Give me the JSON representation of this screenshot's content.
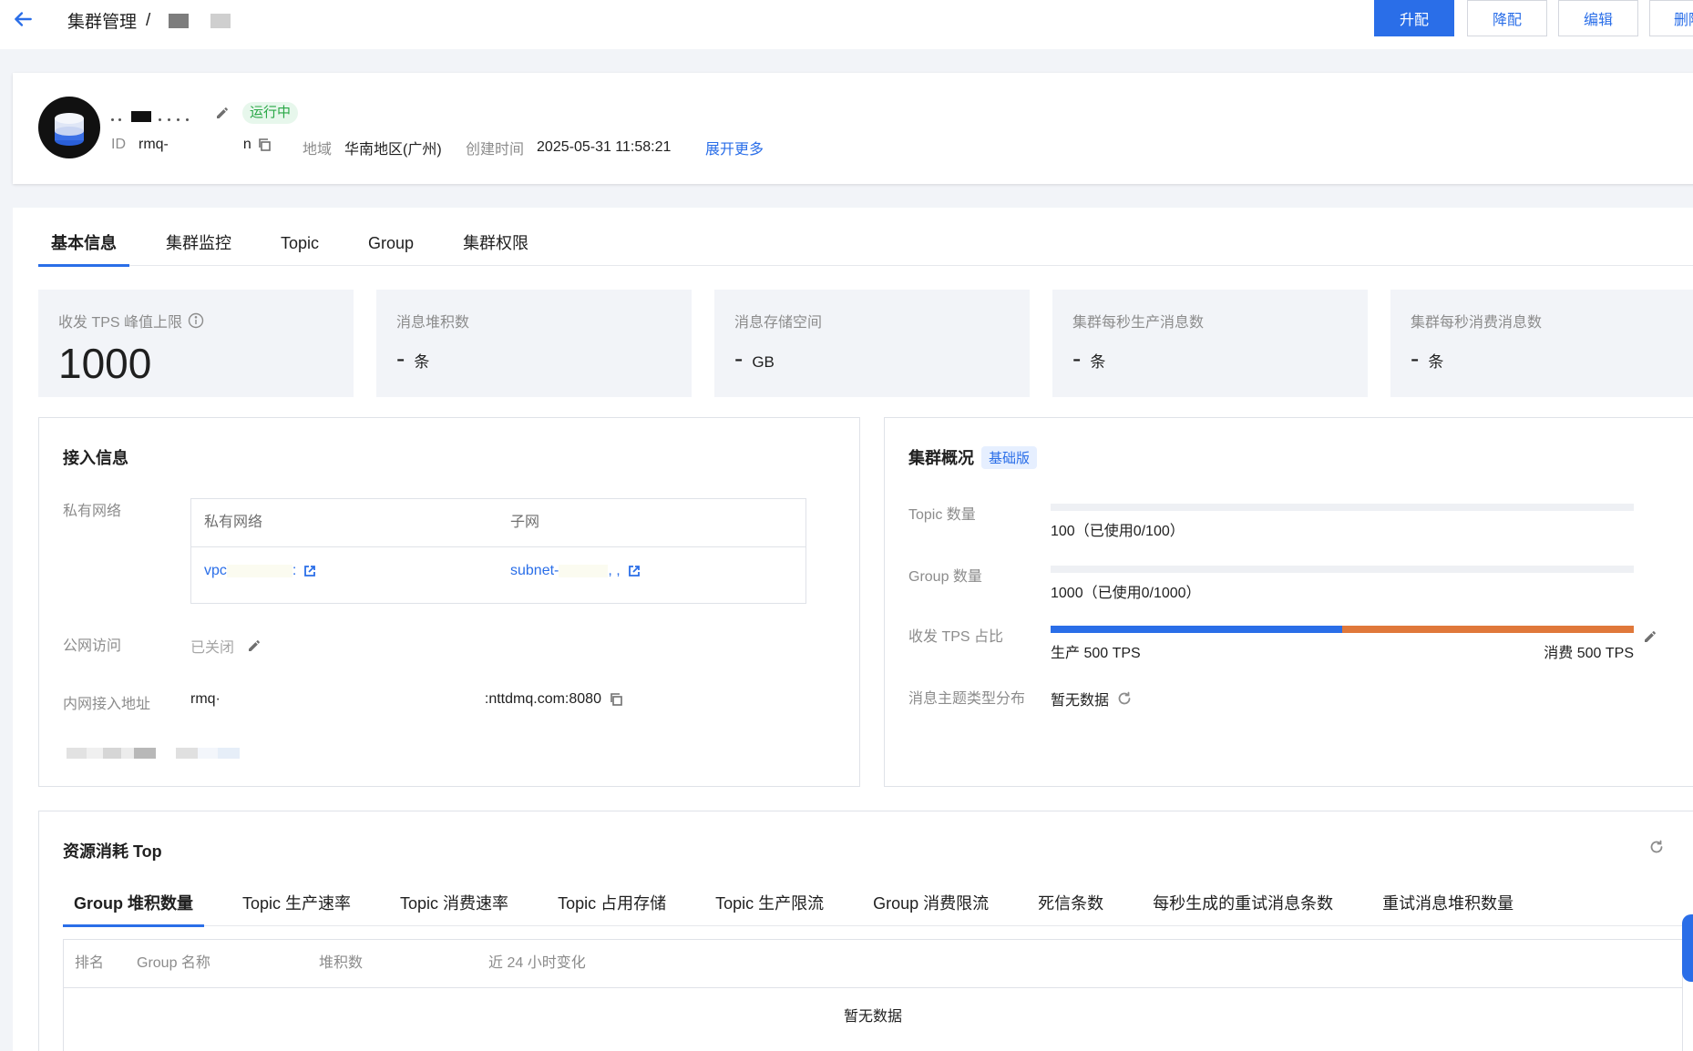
{
  "header": {
    "breadcrumb_root": "集群管理",
    "breadcrumb_sep": "/"
  },
  "toolbar": {
    "upgrade_label": "升配",
    "downgrade_label": "降配",
    "edit_label": "编辑",
    "delete_label": "删除"
  },
  "instance": {
    "status": "运行中",
    "id_label": "ID",
    "id_prefix": "rmq-",
    "id_suffix": "n",
    "region_label": "地域",
    "region_value": "华南地区(广州)",
    "created_label": "创建时间",
    "created_value": "2025-05-31 11:58:21",
    "expand_label": "展开更多"
  },
  "tabs": [
    {
      "label": "基本信息"
    },
    {
      "label": "集群监控"
    },
    {
      "label": "Topic"
    },
    {
      "label": "Group"
    },
    {
      "label": "集群权限"
    }
  ],
  "stats": [
    {
      "label": "收发 TPS 峰值上限",
      "value": "1000",
      "unit": ""
    },
    {
      "label": "消息堆积数",
      "value": "-",
      "unit": "条"
    },
    {
      "label": "消息存储空间",
      "value": "-",
      "unit": "GB"
    },
    {
      "label": "集群每秒生产消息数",
      "value": "-",
      "unit": "条"
    },
    {
      "label": "集群每秒消费消息数",
      "value": "-",
      "unit": "条"
    }
  ],
  "access": {
    "title": "接入信息",
    "vpc_label": "私有网络",
    "table_headers": [
      "私有网络",
      "子网"
    ],
    "vpc_value": "vpc",
    "vpc_tail": ":",
    "subnet_value": "subnet-",
    "subnet_tail": ", ,",
    "public_label": "公网访问",
    "public_value": "已关闭",
    "endpoint_label": "内网接入地址",
    "endpoint_prefix": "rmq·",
    "endpoint_suffix": ":nttdmq.com:8080"
  },
  "overview": {
    "title": "集群概况",
    "edition": "基础版",
    "topic_label": "Topic 数量",
    "topic_value": "100（已使用0/100）",
    "topic_used_fraction": 0,
    "group_label": "Group 数量",
    "group_value": "1000（已使用0/1000）",
    "group_used_fraction": 0,
    "tps_label": "收发 TPS 占比",
    "tps_produce": "生产 500 TPS",
    "tps_consume": "消费 500 TPS",
    "tps_produce_fraction": 0.5,
    "dist_label": "消息主题类型分布",
    "dist_value": "暂无数据"
  },
  "resources": {
    "title": "资源消耗 Top",
    "tabs": [
      {
        "label": "Group 堆积数量"
      },
      {
        "label": "Topic 生产速率"
      },
      {
        "label": "Topic 消费速率"
      },
      {
        "label": "Topic 占用存储"
      },
      {
        "label": "Topic 生产限流"
      },
      {
        "label": "Group 消费限流"
      },
      {
        "label": "死信条数"
      },
      {
        "label": "每秒生成的重试消息条数"
      },
      {
        "label": "重试消息堆积数量"
      }
    ],
    "table_headers": [
      "排名",
      "Group 名称",
      "堆积数",
      "近 24 小时变化"
    ],
    "empty_text": "暂无数据"
  },
  "colors": {
    "accent": "#2a6ee8",
    "running": "#28a745",
    "consume": "#e0783a"
  }
}
